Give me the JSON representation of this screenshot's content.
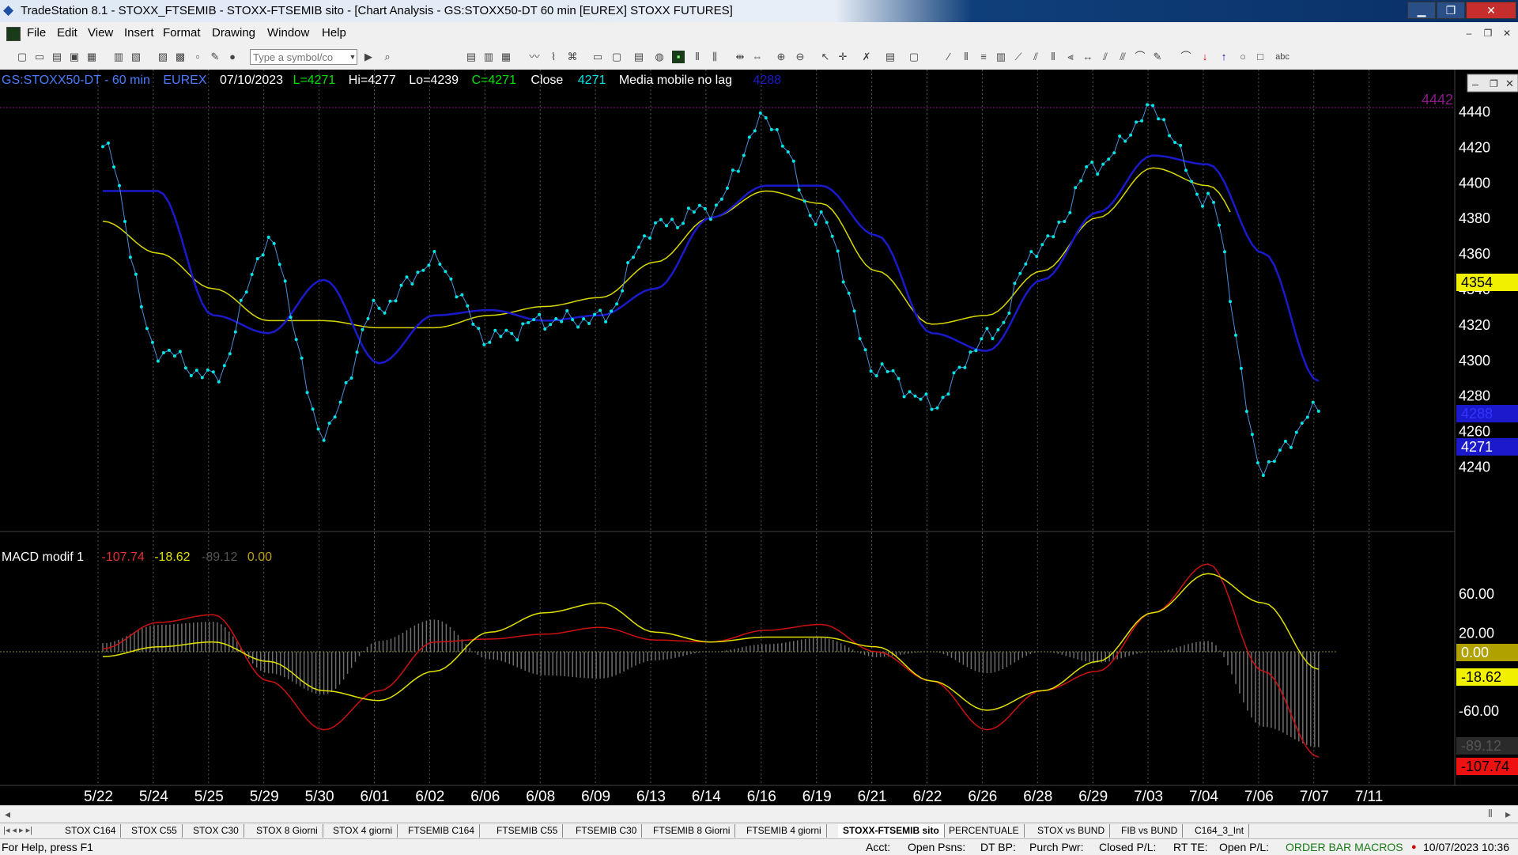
{
  "window": {
    "title": "TradeStation 8.1 - STOXX_FTSEMIB - STOXX-FTSEMIB sito - [Chart Analysis - GS:STOXX50-DT  60 min  [EUREX] STOXX FUTURES]"
  },
  "menu": [
    "File",
    "Edit",
    "View",
    "Insert",
    "Format",
    "Drawing",
    "Window",
    "Help"
  ],
  "toolbar": {
    "symbol_placeholder": "Type a symbol/co",
    "text_tool": "abc"
  },
  "chart": {
    "header": {
      "symbol": "GS:STOXX50-DT - 60 min",
      "exchange": "EUREX",
      "date": "07/10/2023",
      "last": "L=4271",
      "high": "Hi=4277",
      "low": "Lo=4239",
      "close": "C=4271",
      "close_label": "Close",
      "close_value": "4271",
      "indicator_name": "Media mobile no lag",
      "indicator_value": "4288"
    },
    "price_axis": {
      "ticks": [
        "4440",
        "4420",
        "4400",
        "4380",
        "4360",
        "4340",
        "4320",
        "4300",
        "4280",
        "4260",
        "4240"
      ],
      "marker_top": "4442",
      "marker_yellow": "4354",
      "marker_blue": "4288",
      "marker_last": "4271"
    },
    "macd": {
      "name": "MACD modif 1",
      "val1": "-107.74",
      "val2": "-18.62",
      "val3": "-89.12",
      "val4": "0.00",
      "ticks": [
        "60.00",
        "20.00",
        "-60.00"
      ],
      "marker_zero": "0.00",
      "marker_yellow": "-18.62",
      "marker_gray": "-89.12",
      "marker_red": "-107.74"
    },
    "x_labels": [
      "5/22",
      "5/24",
      "5/25",
      "5/29",
      "5/30",
      "6/01",
      "6/02",
      "6/06",
      "6/08",
      "6/09",
      "6/13",
      "6/14",
      "6/16",
      "6/19",
      "6/21",
      "6/22",
      "6/26",
      "6/28",
      "6/29",
      "7/03",
      "7/04",
      "7/06",
      "7/07",
      "7/11"
    ],
    "colors": {
      "price": "#00e5e5",
      "fast_ma": "#1a1acc",
      "slow_ma": "#d8d800",
      "macd_line": "#cc1111",
      "signal_line": "#e0e000",
      "histogram": "#707070",
      "top_marker": "#8a1a8a"
    }
  },
  "chart_data": {
    "type": "line",
    "title": "GS:STOXX50-DT - 60 min",
    "x": [
      "5/22",
      "5/24",
      "5/25",
      "5/29",
      "5/30",
      "6/01",
      "6/02",
      "6/06",
      "6/08",
      "6/09",
      "6/13",
      "6/14",
      "6/16",
      "6/19",
      "6/21",
      "6/22",
      "6/26",
      "6/28",
      "6/29",
      "7/03",
      "7/04",
      "7/06",
      "7/07"
    ],
    "series": [
      {
        "name": "Close",
        "values": [
          4420,
          4305,
          4290,
          4365,
          4260,
          4330,
          4355,
          4312,
          4322,
          4323,
          4375,
          4385,
          4435,
          4378,
          4295,
          4275,
          4312,
          4365,
          4410,
          4440,
          4390,
          4240,
          4271
        ]
      },
      {
        "name": "Media mobile no lag",
        "values": [
          4395,
          4395,
          4325,
          4315,
          4345,
          4298,
          4325,
          4328,
          4322,
          4325,
          4340,
          4380,
          4398,
          4398,
          4370,
          4315,
          4305,
          4345,
          4383,
          4415,
          4410,
          4360,
          4288
        ]
      },
      {
        "values": [
          4378,
          4360,
          4340,
          4322,
          4322,
          4318,
          4318,
          4325,
          4330,
          4335,
          4355,
          4380,
          4395,
          4388,
          4350,
          4320,
          4325,
          4350,
          4380,
          4408,
          4398,
          4355,
          4354
        ]
      }
    ],
    "ylim": [
      4230,
      4445
    ],
    "macd": {
      "name": "MACD modif 1",
      "series": [
        {
          "values": [
            3,
            30,
            38,
            -30,
            -80,
            -40,
            10,
            13,
            18,
            25,
            12,
            10,
            22,
            28,
            0,
            -30,
            -80,
            -40,
            -20,
            40,
            90,
            -20,
            -108
          ]
        },
        {
          "values": [
            -5,
            5,
            10,
            -10,
            -40,
            -50,
            -20,
            20,
            40,
            50,
            20,
            10,
            15,
            15,
            5,
            -30,
            -60,
            -40,
            -10,
            40,
            80,
            50,
            -18
          ]
        },
        {
          "values": [
            8,
            25,
            28,
            -20,
            -40,
            10,
            30,
            -7,
            -22,
            -25,
            -8,
            0,
            7,
            13,
            -5,
            0,
            -20,
            0,
            -10,
            0,
            10,
            -70,
            -89
          ]
        }
      ],
      "ylim": [
        -115,
        95
      ]
    }
  }
}
